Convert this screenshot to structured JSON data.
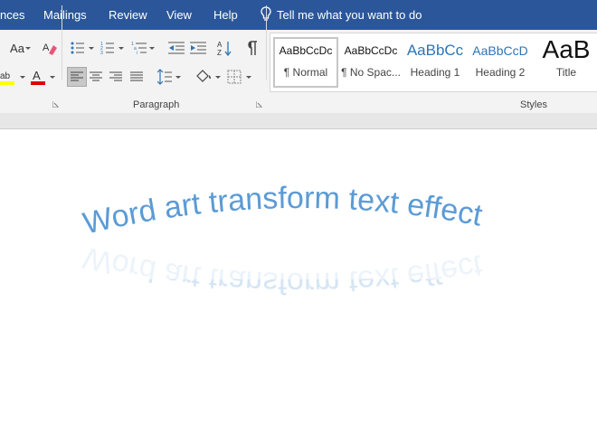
{
  "menu": {
    "items": [
      "nces",
      "Mailings",
      "Review",
      "View",
      "Help"
    ],
    "tell_me": "Tell me what you want to do"
  },
  "ribbon": {
    "font_group": {
      "change_case_label": "Aa"
    },
    "paragraph": {
      "label": "Paragraph"
    },
    "styles": {
      "label": "Styles",
      "tiles": [
        {
          "preview": "AaBbCcDc",
          "name": "¶ Normal"
        },
        {
          "preview": "AaBbCcDc",
          "name": "¶ No Spac..."
        },
        {
          "preview": "AaBbCc",
          "name": "Heading 1"
        },
        {
          "preview": "AaBbCcD",
          "name": "Heading 2"
        },
        {
          "preview": "AaB",
          "name": "Title"
        }
      ]
    }
  },
  "colors": {
    "menu_bg": "#2b579a",
    "highlight_yellow": "#ffff00",
    "font_red": "#e00000",
    "heading_blue": "#2e74b5",
    "wordart_blue": "#5b9bd5"
  },
  "document": {
    "wordart_text": "Word art transform text effect"
  }
}
